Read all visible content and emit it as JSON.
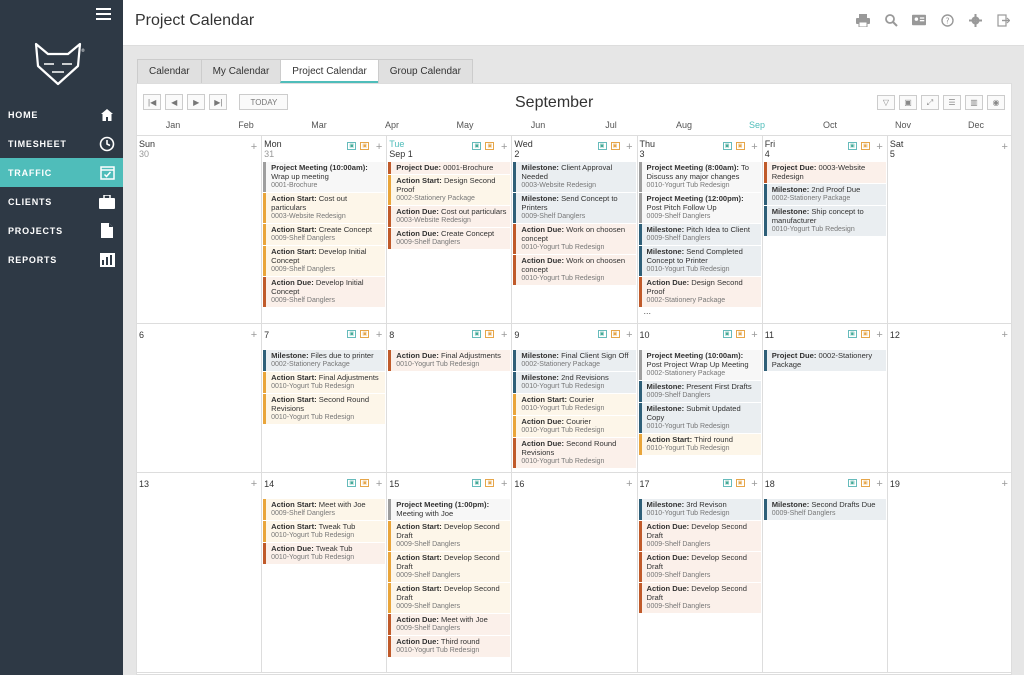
{
  "app": {
    "page_title": "Project Calendar"
  },
  "sidebar": {
    "items": [
      {
        "label": "HOME",
        "icon": "home-icon"
      },
      {
        "label": "TIMESHEET",
        "icon": "clock-icon"
      },
      {
        "label": "TRAFFIC",
        "icon": "calendar-check-icon"
      },
      {
        "label": "CLIENTS",
        "icon": "briefcase-icon"
      },
      {
        "label": "PROJECTS",
        "icon": "document-icon"
      },
      {
        "label": "REPORTS",
        "icon": "bar-chart-icon"
      }
    ]
  },
  "topbar_icons": [
    "print-icon",
    "search-icon",
    "id-card-icon",
    "help-icon",
    "settings-icon",
    "logout-icon"
  ],
  "tabs": [
    "Calendar",
    "My Calendar",
    "Project Calendar",
    "Group Calendar"
  ],
  "controls": {
    "today_label": "TODAY"
  },
  "month_title": "September",
  "months": [
    "Jan",
    "Feb",
    "Mar",
    "Apr",
    "May",
    "Jun",
    "Jul",
    "Aug",
    "Sep",
    "Oct",
    "Nov",
    "Dec"
  ],
  "weeks": [
    {
      "days": [
        {
          "name": "Sun",
          "num": "30",
          "gray": true,
          "events": []
        },
        {
          "name": "Mon",
          "num": "31",
          "gray": true,
          "events": [
            {
              "type": "meeting",
              "title": "Project Meeting (10:00am):",
              "text": " Wrap up meeting",
              "sub": "0001-Brochure"
            },
            {
              "type": "start",
              "title": "Action Start:",
              "text": " Cost out particulars",
              "sub": "0003-Website Redesign"
            },
            {
              "type": "start",
              "title": "Action Start:",
              "text": " Create Concept",
              "sub": "0009-Shelf Danglers"
            },
            {
              "type": "start",
              "title": "Action Start:",
              "text": " Develop Initial Concept",
              "sub": "0009-Shelf Danglers"
            },
            {
              "type": "due",
              "title": "Action Due:",
              "text": " Develop Initial Concept",
              "sub": "0009-Shelf Danglers"
            }
          ]
        },
        {
          "name": "Tue",
          "num": "Sep 1",
          "today": true,
          "events": [
            {
              "type": "due",
              "title": "Project Due:",
              "text": " 0001-Brochure",
              "sub": ""
            },
            {
              "type": "start",
              "title": "Action Start:",
              "text": " Design Second Proof",
              "sub": "0002-Stationery Package"
            },
            {
              "type": "due",
              "title": "Action Due:",
              "text": " Cost out particulars",
              "sub": "0003-Website Redesign"
            },
            {
              "type": "due",
              "title": "Action Due:",
              "text": " Create Concept",
              "sub": "0009-Shelf Danglers"
            }
          ]
        },
        {
          "name": "Wed",
          "num": "2",
          "events": [
            {
              "type": "milestone",
              "title": "Milestone:",
              "text": " Client Approval Needed",
              "sub": "0003-Website Redesign"
            },
            {
              "type": "milestone",
              "title": "Milestone:",
              "text": " Send Concept to Printers",
              "sub": "0009-Shelf Danglers"
            },
            {
              "type": "due",
              "title": "Action Due:",
              "text": " Work on choosen concept",
              "sub": "0010-Yogurt Tub Redesign"
            },
            {
              "type": "due",
              "title": "Action Due:",
              "text": " Work on choosen concept",
              "sub": "0010-Yogurt Tub Redesign"
            }
          ]
        },
        {
          "name": "Thu",
          "num": "3",
          "more": "...",
          "events": [
            {
              "type": "meeting",
              "title": "Project Meeting (8:00am):",
              "text": " To Discuss any major changes",
              "sub": "0010-Yogurt Tub Redesign"
            },
            {
              "type": "meeting",
              "title": "Project Meeting (12:00pm):",
              "text": " Post Pitch Follow Up",
              "sub": "0009-Shelf Danglers"
            },
            {
              "type": "milestone",
              "title": "Milestone:",
              "text": " Pitch Idea to Client",
              "sub": "0009-Shelf Danglers"
            },
            {
              "type": "milestone",
              "title": "Milestone:",
              "text": " Send Completed Concept to Printer",
              "sub": "0010-Yogurt Tub Redesign"
            },
            {
              "type": "due",
              "title": "Action Due:",
              "text": " Design Second Proof",
              "sub": "0002-Stationery Package"
            }
          ]
        },
        {
          "name": "Fri",
          "num": "4",
          "events": [
            {
              "type": "due",
              "title": "Project Due:",
              "text": " 0003-Website Redesign",
              "sub": ""
            },
            {
              "type": "milestone",
              "title": "Milestone:",
              "text": " 2nd Proof Due",
              "sub": "0002-Stationery Package"
            },
            {
              "type": "milestone",
              "title": "Milestone:",
              "text": " Ship concept to manufacturer",
              "sub": "0010-Yogurt Tub Redesign"
            }
          ]
        },
        {
          "name": "Sat",
          "num": "5",
          "events": []
        }
      ]
    },
    {
      "days": [
        {
          "num": "6",
          "events": []
        },
        {
          "num": "7",
          "events": [
            {
              "type": "milestone",
              "title": "Milestone:",
              "text": " Files due to printer",
              "sub": "0002-Stationery Package"
            },
            {
              "type": "start",
              "title": "Action Start:",
              "text": " Final Adjustments",
              "sub": "0010-Yogurt Tub Redesign"
            },
            {
              "type": "start",
              "title": "Action Start:",
              "text": " Second Round Revisions",
              "sub": "0010-Yogurt Tub Redesign"
            }
          ]
        },
        {
          "num": "8",
          "events": [
            {
              "type": "due",
              "title": "Action Due:",
              "text": " Final Adjustments",
              "sub": "0010-Yogurt Tub Redesign"
            }
          ]
        },
        {
          "num": "9",
          "events": [
            {
              "type": "milestone",
              "title": "Milestone:",
              "text": " Final Client Sign Off",
              "sub": "0002-Stationery Package"
            },
            {
              "type": "milestone",
              "title": "Milestone:",
              "text": " 2nd Revisions",
              "sub": "0010-Yogurt Tub Redesign"
            },
            {
              "type": "start",
              "title": "Action Start:",
              "text": " Courier",
              "sub": "0010-Yogurt Tub Redesign"
            },
            {
              "type": "start",
              "title": "Action Due:",
              "text": " Courier",
              "sub": "0010-Yogurt Tub Redesign"
            },
            {
              "type": "due",
              "title": "Action Due:",
              "text": " Second Round Revisions",
              "sub": "0010-Yogurt Tub Redesign"
            }
          ]
        },
        {
          "num": "10",
          "events": [
            {
              "type": "meeting",
              "title": "Project Meeting (10:00am):",
              "text": " Post Project Wrap Up Meeting",
              "sub": "0002-Stationery Package"
            },
            {
              "type": "milestone",
              "title": "Milestone:",
              "text": " Present First Drafts",
              "sub": "0009-Shelf Danglers"
            },
            {
              "type": "milestone",
              "title": "Milestone:",
              "text": " Submit Updated Copy",
              "sub": "0010-Yogurt Tub Redesign"
            },
            {
              "type": "start",
              "title": "Action Start:",
              "text": " Third round",
              "sub": "0010-Yogurt Tub Redesign"
            }
          ]
        },
        {
          "num": "11",
          "events": [
            {
              "type": "milestone",
              "title": "Project Due:",
              "text": " 0002-Stationery Package",
              "sub": ""
            }
          ]
        },
        {
          "num": "12",
          "events": []
        }
      ]
    },
    {
      "days": [
        {
          "num": "13",
          "events": []
        },
        {
          "num": "14",
          "events": [
            {
              "type": "start",
              "title": "Action Start:",
              "text": " Meet with Joe",
              "sub": "0009-Shelf Danglers"
            },
            {
              "type": "start",
              "title": "Action Start:",
              "text": " Tweak Tub",
              "sub": "0010-Yogurt Tub Redesign"
            },
            {
              "type": "due",
              "title": "Action Due:",
              "text": " Tweak Tub",
              "sub": "0010-Yogurt Tub Redesign"
            }
          ]
        },
        {
          "num": "15",
          "events": [
            {
              "type": "meeting",
              "title": "Project Meeting (1:00pm):",
              "text": " Meeting with Joe",
              "sub": ""
            },
            {
              "type": "start",
              "title": "Action Start:",
              "text": " Develop Second Draft",
              "sub": "0009-Shelf Danglers"
            },
            {
              "type": "start",
              "title": "Action Start:",
              "text": " Develop Second Draft",
              "sub": "0009-Shelf Danglers"
            },
            {
              "type": "start",
              "title": "Action Start:",
              "text": " Develop Second Draft",
              "sub": "0009-Shelf Danglers"
            },
            {
              "type": "due",
              "title": "Action Due:",
              "text": " Meet with Joe",
              "sub": "0009-Shelf Danglers"
            },
            {
              "type": "due",
              "title": "Action Due:",
              "text": " Third round",
              "sub": "0010-Yogurt Tub Redesign"
            }
          ]
        },
        {
          "num": "16",
          "events": []
        },
        {
          "num": "17",
          "events": [
            {
              "type": "milestone",
              "title": "Milestone:",
              "text": " 3rd Revison",
              "sub": "0010-Yogurt Tub Redesign"
            },
            {
              "type": "due",
              "title": "Action Due:",
              "text": " Develop Second Draft",
              "sub": "0009-Shelf Danglers"
            },
            {
              "type": "due",
              "title": "Action Due:",
              "text": " Develop Second Draft",
              "sub": "0009-Shelf Danglers"
            },
            {
              "type": "due",
              "title": "Action Due:",
              "text": " Develop Second Draft",
              "sub": "0009-Shelf Danglers"
            }
          ]
        },
        {
          "num": "18",
          "events": [
            {
              "type": "milestone",
              "title": "Milestone:",
              "text": " Second Drafts Due",
              "sub": "0009-Shelf Danglers"
            }
          ]
        },
        {
          "num": "19",
          "events": []
        }
      ]
    }
  ]
}
